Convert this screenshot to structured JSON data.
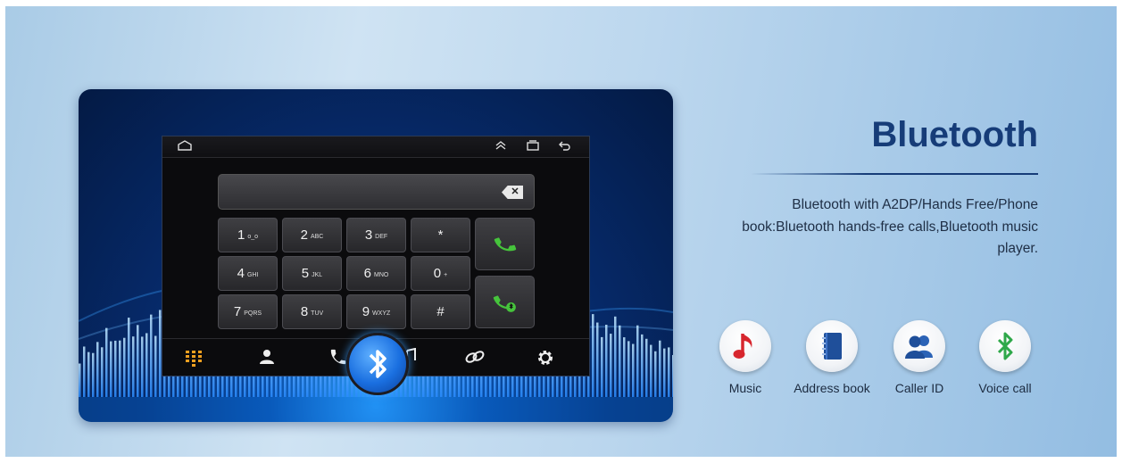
{
  "banner": {
    "title": "Bluetooth",
    "description": "Bluetooth with A2DP/Hands Free/Phone book:Bluetooth hands-free calls,Bluetooth music player."
  },
  "dialer": {
    "keys": [
      {
        "digit": "1",
        "letters": "ᴏ_ᴏ"
      },
      {
        "digit": "2",
        "letters": "ABC"
      },
      {
        "digit": "3",
        "letters": "DEF"
      },
      {
        "digit": "*",
        "letters": ""
      },
      {
        "digit": "4",
        "letters": "GHI"
      },
      {
        "digit": "5",
        "letters": "JKL"
      },
      {
        "digit": "6",
        "letters": "MNO"
      },
      {
        "digit": "0",
        "letters": "+"
      },
      {
        "digit": "7",
        "letters": "PQRS"
      },
      {
        "digit": "8",
        "letters": "TUV"
      },
      {
        "digit": "9",
        "letters": "WXYZ"
      },
      {
        "digit": "#",
        "letters": ""
      }
    ],
    "status_icons": [
      "home-icon",
      "chevron-up-icon",
      "recent-apps-icon",
      "back-icon"
    ],
    "tabs": [
      "dialpad-icon",
      "contacts-icon",
      "call-log-icon",
      "music-icon",
      "link-icon",
      "settings-icon"
    ]
  },
  "features": [
    {
      "label": "Music",
      "icon": "music-note-icon",
      "color": "#d7262e"
    },
    {
      "label": "Address book",
      "icon": "address-book-icon",
      "color": "#1f4f9a"
    },
    {
      "label": "Caller ID",
      "icon": "caller-id-icon",
      "color": "#1f4f9a"
    },
    {
      "label": "Voice call",
      "icon": "bluetooth-icon",
      "color": "#2fa84a"
    }
  ],
  "colors": {
    "title": "#163c78",
    "accent_green": "#46c43c",
    "tab_active": "#f0a020"
  }
}
